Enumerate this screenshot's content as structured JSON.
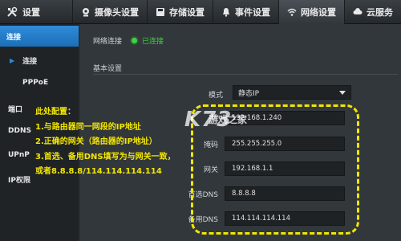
{
  "header": {
    "settings_label": "设置",
    "tabs": [
      {
        "label": "摄像头设置",
        "icon": "camera-icon"
      },
      {
        "label": "存储设置",
        "icon": "storage-icon"
      },
      {
        "label": "事件设置",
        "icon": "bell-icon"
      },
      {
        "label": "网络设置",
        "icon": "wifi-icon",
        "active": true
      },
      {
        "label": "云服务",
        "icon": "cloud-icon"
      }
    ]
  },
  "sidebar": {
    "items": [
      {
        "label": "连接",
        "state": "group-active"
      },
      {
        "label": "连接",
        "state": "current"
      },
      {
        "label": "PPPoE"
      },
      {
        "label": "端口"
      },
      {
        "label": "DDNS"
      },
      {
        "label": "UPnP"
      },
      {
        "label": "IP权限"
      }
    ]
  },
  "main": {
    "connection_label": "网络连接",
    "connection_status": "已连接",
    "section_title": "基本设置",
    "mode": {
      "label": "模式",
      "value": "静态IP"
    },
    "fields": [
      {
        "label": "IP",
        "value": "192.168.1.240"
      },
      {
        "label": "掩码",
        "value": "255.255.255.0"
      },
      {
        "label": "网关",
        "value": "192.168.1.1"
      },
      {
        "label": "首选DNS",
        "value": "8.8.8.8"
      },
      {
        "label": "备用DNS",
        "value": "114.114.114.114"
      }
    ]
  },
  "annotation": {
    "lines": [
      "此处配置：",
      "1.与路由器同一网段的IP地址",
      "2.正确的网关（路由器的IP地址）",
      "3.首选、备用DNS填写为与网关一致，",
      "或者8.8.8.8/114.114.114.114"
    ]
  },
  "watermark": {
    "logo": "K73",
    "text": "游戏之家"
  },
  "colors": {
    "accent": "#2f8bd8",
    "annotation": "#f2e600",
    "connected": "#3fd23f"
  }
}
